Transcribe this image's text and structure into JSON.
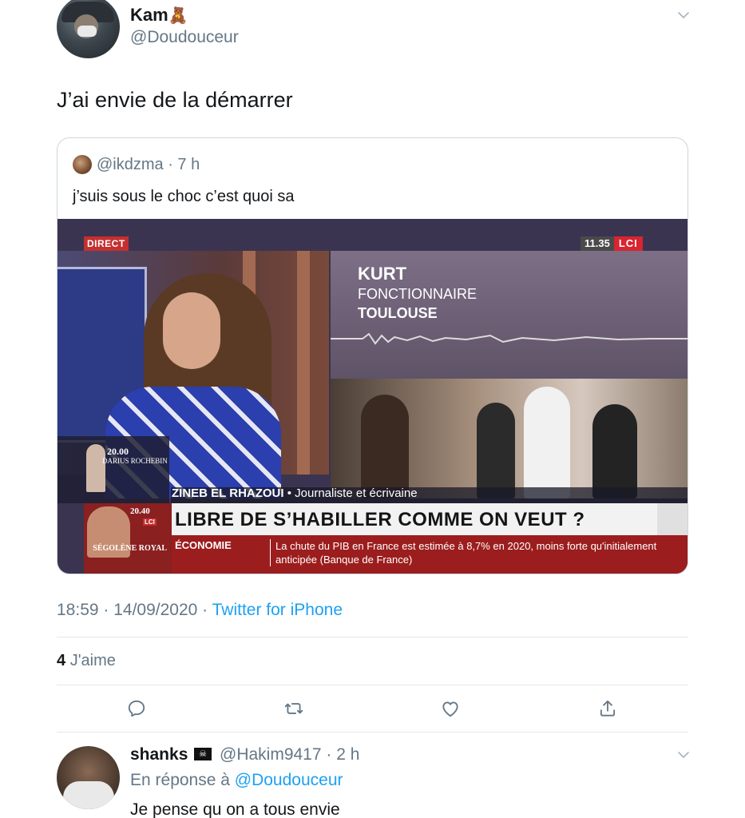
{
  "tweet": {
    "display_name": "Kam",
    "name_emoji": "🧸",
    "handle": "@Doudouceur",
    "text": "J’ai envie de la démarrer",
    "timestamp": "18:59 · 14/09/2020 · ",
    "source": "Twitter for iPhone",
    "likes_count": "4",
    "likes_label": "J'aime"
  },
  "quoted": {
    "handle_meta": "@ikdzma · 7 h",
    "text": "j’suis sous le choc c’est quoi sa",
    "video": {
      "live_badge": "DIRECT",
      "clock": "11.35",
      "channel": "LCI",
      "interviewee_name": "KURT",
      "interviewee_job": "FONCTIONNAIRE",
      "interviewee_city": "TOULOUSE",
      "schedule_1_time": "20.00",
      "schedule_1_name": "DARIUS ROCHEBIN",
      "speaker_name": "ZINEB EL RHAZOUI",
      "speaker_role": " • Journaliste et écrivaine",
      "schedule_2_time": "20.40",
      "schedule_2_channel": "LCI",
      "schedule_2_name": "SÉGOLÈNE ROYAL",
      "headline": "LIBRE DE S’HABILLER COMME ON VEUT ?",
      "ticker_category": "ÉCONOMIE",
      "ticker_text": "La chute du PIB en France est estimée à 8,7% en 2020, moins forte qu'initialement anticipée (Banque de France)"
    }
  },
  "actions": [
    "reply-icon",
    "retweet-icon",
    "like-icon",
    "share-icon"
  ],
  "reply": {
    "display_name": "shanks",
    "flag_emoji": "🏴‍☠️",
    "handle_meta": "@Hakim9417 · 2 h",
    "in_reply_to_prefix": "En réponse à ",
    "in_reply_to_mention": "@Doudouceur",
    "text": "Je pense qu on a tous envie"
  },
  "colors": {
    "accent": "#1da1f2",
    "secondary_text": "#657786",
    "primary_text": "#14171a",
    "divider": "#e1e8ed"
  }
}
